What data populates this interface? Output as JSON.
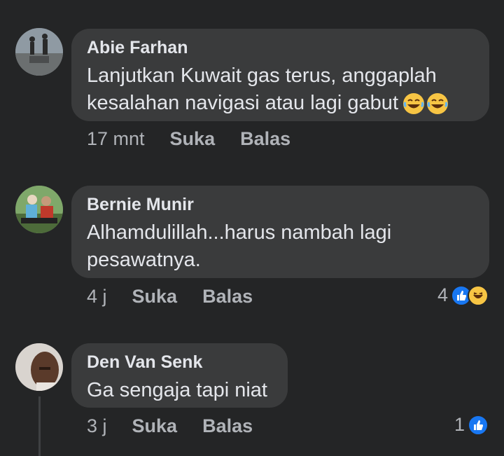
{
  "comments": [
    {
      "author": "Abie Farhan",
      "text_line1": "Lanjutkan Kuwait gas terus, anggaplah",
      "text_line2": "kesalahan navigasi atau lagi gabut",
      "emoji": "laughing-tears-icon",
      "time": "17 mnt",
      "like_label": "Suka",
      "reply_label": "Balas"
    },
    {
      "author": "Bernie Munir",
      "text_line1": "Alhamdulillah...harus nambah lagi",
      "text_line2": "pesawatnya.",
      "time": "4 j",
      "like_label": "Suka",
      "reply_label": "Balas",
      "reaction_count": "4",
      "reaction_icons": [
        "like-icon",
        "haha-icon"
      ]
    },
    {
      "author": "Den Van Senk",
      "text_line1": "Ga sengaja tapi niat",
      "time": "3 j",
      "like_label": "Suka",
      "reply_label": "Balas",
      "reaction_count": "1",
      "reaction_icons": [
        "like-icon"
      ]
    }
  ],
  "colors": {
    "background": "#242526",
    "bubble": "#3a3b3c",
    "text": "#e4e6eb",
    "meta": "#b0b3b8",
    "like_blue": "#1877f2",
    "haha_yellow": "#f7c544"
  }
}
